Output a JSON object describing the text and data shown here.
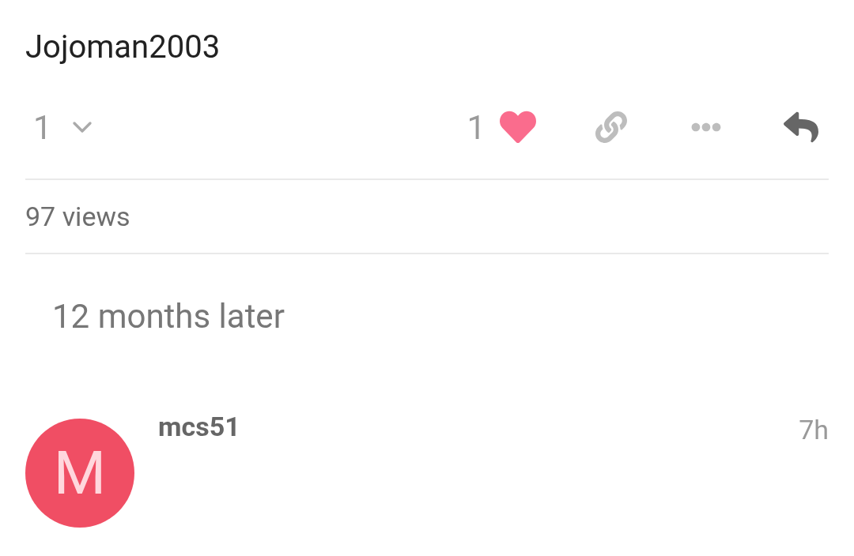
{
  "post": {
    "username": "Jojoman2003",
    "replies": {
      "count": "1",
      "expanded": false
    },
    "likes": {
      "count": "1",
      "liked": true
    },
    "views": "97 views"
  },
  "time_gap": "12 months later",
  "next_post": {
    "avatar_letter": "M",
    "username": "mcs51",
    "time": "7h"
  }
}
